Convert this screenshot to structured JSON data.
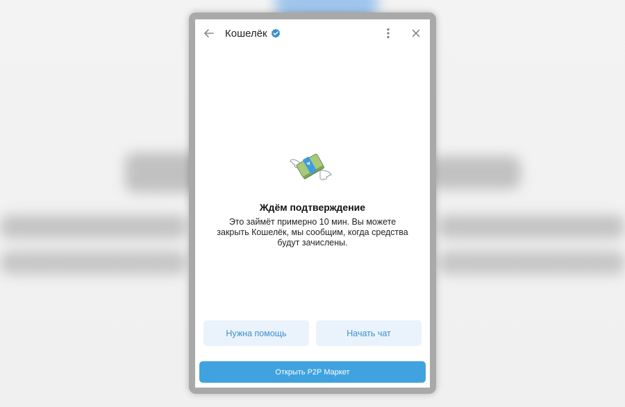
{
  "header": {
    "title": "Кошелёк"
  },
  "status": {
    "title": "Ждём подтверждение",
    "message": "Это займёт примерно 10 мин. Вы можете закрыть Кошелёк, мы сообщим, когда средства будут зачислены."
  },
  "actions": {
    "help_label": "Нужна помощь",
    "chat_label": "Начать чат",
    "p2p_label": "Открыть P2P Маркет"
  },
  "icons": {
    "back": "arrow-left-icon",
    "verified": "verified-badge-icon",
    "menu": "more-vertical-icon",
    "close": "close-icon",
    "illustration": "flying-money-icon"
  },
  "colors": {
    "accent": "#40a3df",
    "secondary_bg": "#eaf3fb",
    "secondary_text": "#3b8fd0",
    "verified": "#3b8fd0"
  }
}
